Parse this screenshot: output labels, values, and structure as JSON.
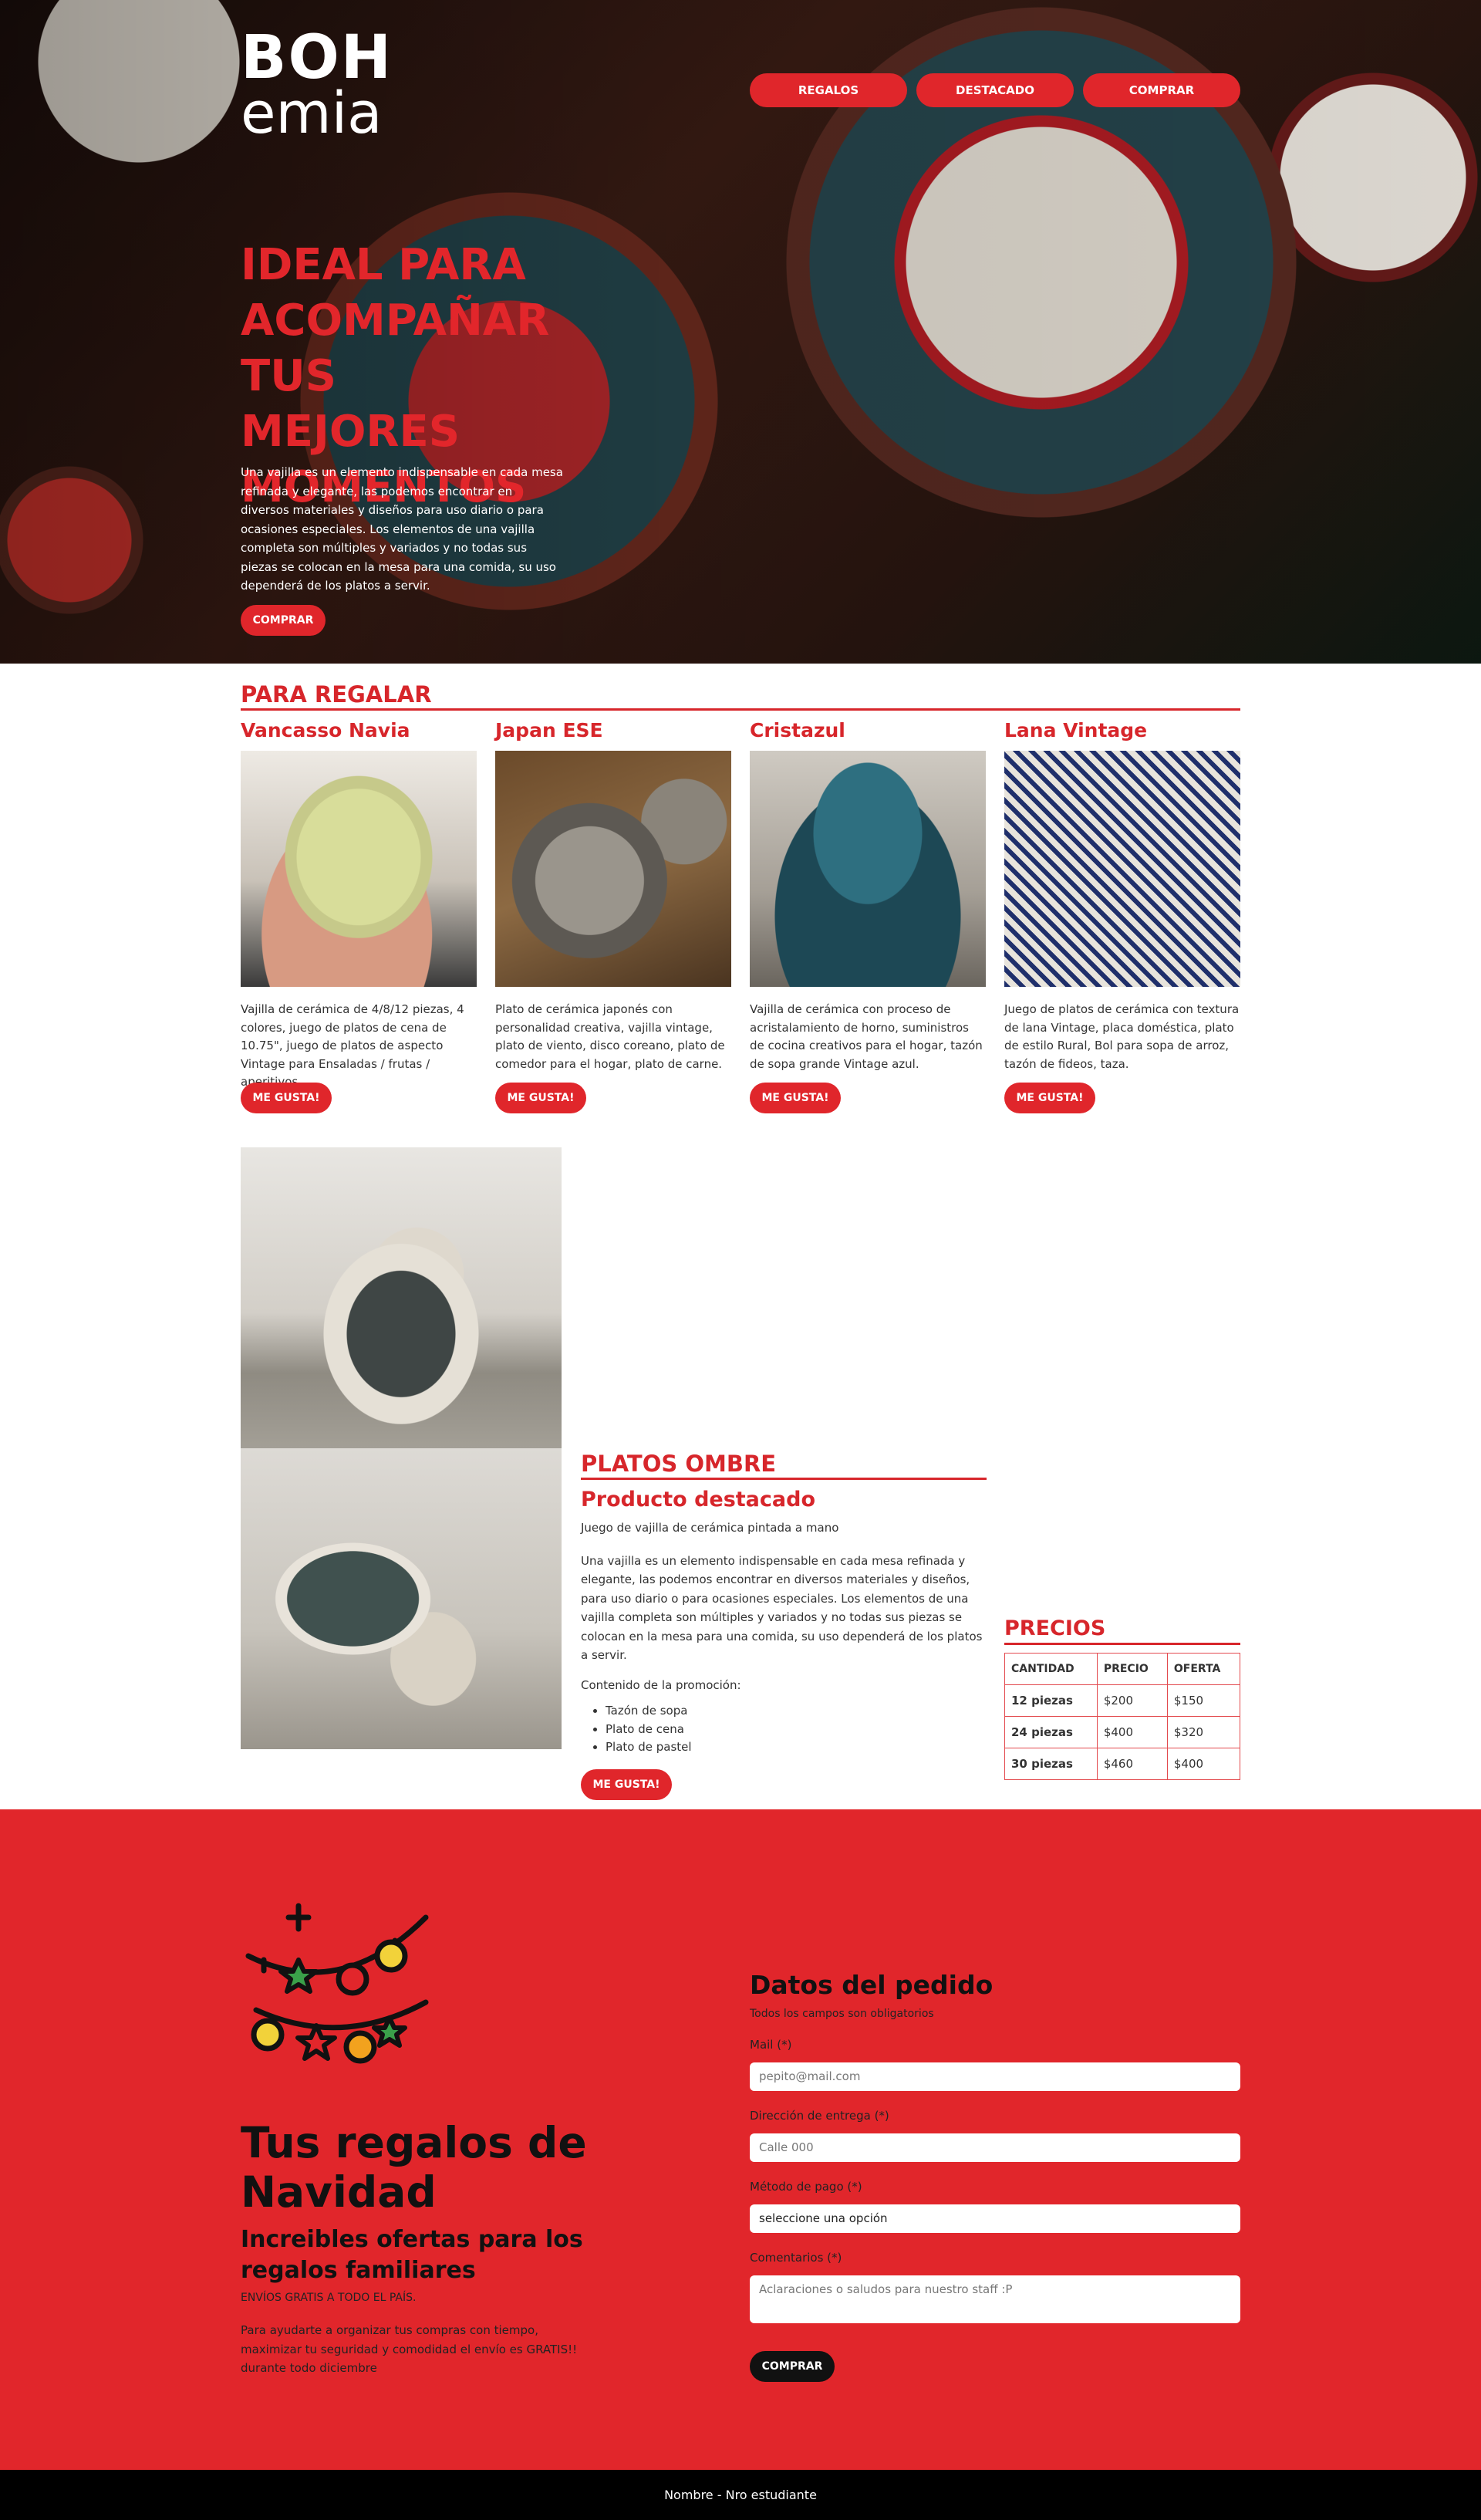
{
  "brand": {
    "logo_line1": "BOH",
    "logo_line2": "emia"
  },
  "nav": [
    "REGALOS",
    "DESTACADO",
    "COMPRAR"
  ],
  "hero": {
    "title": "IDEAL PARA ACOMPAÑAR TUS MEJORES MOMENTOS",
    "text": "Una vajilla es un elemento indispensable en cada mesa refinada y elegante, las podemos encontrar en diversos materiales y diseños para uso diario o para ocasiones especiales. Los elementos de una vajilla completa son múltiples y variados y no todas sus piezas se colocan en la mesa para una comida, su uso dependerá de los platos a servir.",
    "button": "COMPRAR"
  },
  "gifts": {
    "title": "PARA REGALAR",
    "like_label": "ME GUSTA!",
    "products": [
      {
        "name": "Vancasso Navia",
        "desc": "Vajilla de cerámica de 4/8/12 piezas, 4 colores, juego de platos de cena de 10.75\", juego de platos de aspecto Vintage para Ensaladas / frutas / aperitivos"
      },
      {
        "name": "Japan ESE",
        "desc": "Plato de cerámica japonés con personalidad creativa, vajilla vintage, plato de viento, disco coreano, plato de comedor para el hogar, plato de carne."
      },
      {
        "name": "Cristazul",
        "desc": "Vajilla de cerámica con proceso de acristalamiento de horno, suministros de cocina creativos para el hogar, tazón de sopa grande Vintage azul."
      },
      {
        "name": "Lana Vintage",
        "desc": "Juego de platos de cerámica con textura de lana Vintage, placa doméstica, plato de estilo Rural, Bol para sopa de arroz, tazón de fideos, taza."
      }
    ]
  },
  "featured": {
    "title": "PLATOS OMBRE",
    "subtitle": "Producto destacado",
    "tagline": "Juego de vajilla de cerámica pintada a mano",
    "text": "Una vajilla es un elemento indispensable en cada mesa refinada y elegante, las podemos encontrar en diversos materiales y diseños, para uso diario o para ocasiones especiales. Los elementos de una vajilla completa son múltiples y variados y no todas sus piezas se colocan en la mesa para una comida, su uso dependerá de los platos a servir.",
    "contents_label": "Contenido de la promoción:",
    "items": [
      "Tazón de sopa",
      "Plato de cena",
      "Plato de pastel"
    ],
    "button": "ME GUSTA!"
  },
  "prices": {
    "title": "PRECIOS",
    "headers": [
      "CANTIDAD",
      "PRECIO",
      "OFERTA"
    ],
    "rows": [
      [
        "12 piezas",
        "$200",
        "$150"
      ],
      [
        "24 piezas",
        "$400",
        "$320"
      ],
      [
        "30 piezas",
        "$460",
        "$400"
      ]
    ]
  },
  "promo": {
    "title": "Tus regalos de Navidad",
    "subtitle": "Increibles ofertas para los regalos familiares",
    "small": "ENVÍOS GRATIS A TODO EL PAÍS.",
    "text": "Para ayudarte a organizar tus compras con tiempo, maximizar tu seguridad y comodidad el envío es GRATIS!! durante todo diciembre"
  },
  "form": {
    "title": "Datos del pedido",
    "required_note": "Todos los campos son obligatorios",
    "mail_label": "Mail (*)",
    "mail_placeholder": "pepito@mail.com",
    "address_label": "Dirección de entrega (*)",
    "address_placeholder": "Calle 000",
    "payment_label": "Método de pago (*)",
    "payment_value": "seleccione una opción",
    "comments_label": "Comentarios (*)",
    "comments_placeholder": "Aclaraciones o saludos para nuestro staff :P",
    "submit": "COMPRAR"
  },
  "footer": {
    "text": "Nombre - Nro estudiante"
  },
  "colors": {
    "accent": "#e1262b",
    "dark": "#111111"
  }
}
